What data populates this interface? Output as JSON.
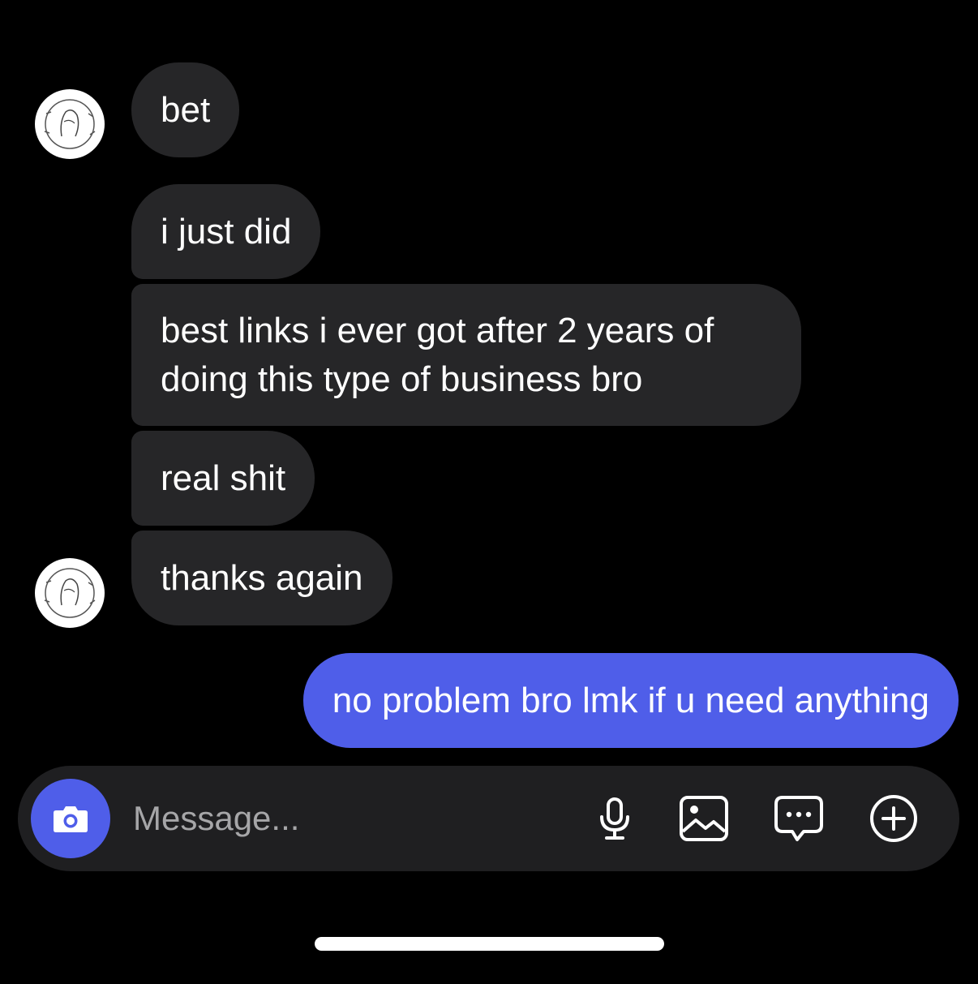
{
  "thread": {
    "messages": [
      {
        "direction": "incoming",
        "text": "bet"
      },
      {
        "direction": "incoming",
        "text": "i just did"
      },
      {
        "direction": "incoming",
        "text": "best links i ever got after 2 years of doing this type of business bro"
      },
      {
        "direction": "incoming",
        "text": "real shit"
      },
      {
        "direction": "incoming",
        "text": "thanks again"
      },
      {
        "direction": "outgoing",
        "text": "no problem bro lmk if u need anything"
      }
    ]
  },
  "composer": {
    "placeholder": "Message...",
    "icons": [
      "camera-icon",
      "microphone-icon",
      "image-icon",
      "sticker-icon",
      "plus-icon"
    ]
  },
  "colors": {
    "background": "#000000",
    "incoming_bubble": "#262628",
    "outgoing_bubble": "#4f5ee9",
    "composer": "#1f1f21"
  }
}
